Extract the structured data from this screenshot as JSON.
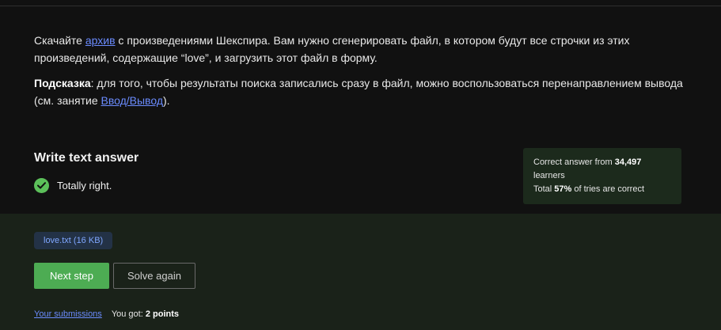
{
  "task": {
    "p1_prefix": "Скачайте ",
    "p1_link": "архив",
    "p1_suffix": " с произведениями Шекспира. Вам нужно сгенерировать файл, в котором будут все строчки из этих произведений, содержащие “love”, и загрузить этот файл в форму.",
    "hint_label": "Подсказка",
    "hint_text": ": для того, чтобы результаты поиска записались сразу в файл, можно воспользоваться перенаправлением вывода (см. занятие ",
    "hint_link": "Ввод/Вывод",
    "hint_end": ")."
  },
  "answer": {
    "title": "Write text answer",
    "result": "Totally right."
  },
  "stats": {
    "correct_prefix": "Correct answer from ",
    "learners_count": "34,497",
    "learners_suffix": " learners",
    "total_prefix": "Total ",
    "percent": "57%",
    "total_suffix": " of tries are correct"
  },
  "file": {
    "label": "love.txt (16 KB)"
  },
  "buttons": {
    "next_step": "Next step",
    "solve_again": "Solve again"
  },
  "footer": {
    "submissions_link": "Your submissions",
    "score_prefix": "You got: ",
    "score_value": "2 points"
  },
  "colors": {
    "background": "#111111",
    "bottom_panel": "#1a2219",
    "accent_green": "#4dac53",
    "check_green": "#5cc05a",
    "link_blue": "#6b8cff"
  },
  "icons": {
    "result": "check-circle-icon"
  }
}
